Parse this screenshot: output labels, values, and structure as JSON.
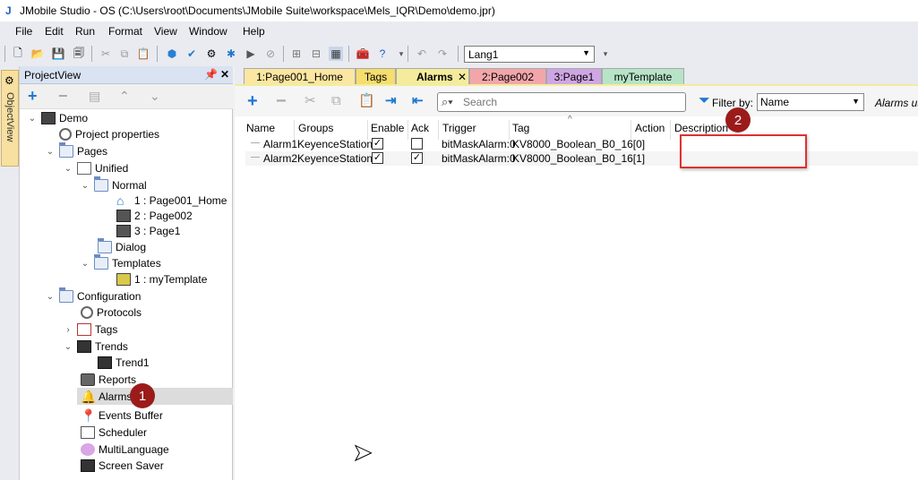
{
  "window": {
    "title": "JMobile Studio - OS (C:\\Users\\root\\Documents\\JMobile Suite\\workspace\\Mels_IQR\\Demo\\demo.jpr)",
    "logo": "J"
  },
  "menu": [
    "File",
    "Edit",
    "Run",
    "Format",
    "View",
    "Window",
    "Help"
  ],
  "toolbar": {
    "language": "Lang1"
  },
  "objectview": {
    "label": "ObjectView"
  },
  "projectview": {
    "title": "ProjectView",
    "tree": [
      {
        "label": "Demo",
        "icon": "monitor-icon",
        "expanded": true
      },
      {
        "label": "Project properties",
        "icon": "gear-icon"
      },
      {
        "label": "Pages",
        "icon": "folder-icon",
        "expanded": true
      },
      {
        "label": "Unified",
        "icon": "page-icon",
        "expanded": true
      },
      {
        "label": "Normal",
        "icon": "folder-icon",
        "expanded": true
      },
      {
        "label": "1 : Page001_Home",
        "icon": "home-icon"
      },
      {
        "label": "2 : Page002",
        "icon": "page-icon"
      },
      {
        "label": "3 : Page1",
        "icon": "page-icon"
      },
      {
        "label": "Dialog",
        "icon": "folder-icon"
      },
      {
        "label": "Templates",
        "icon": "folder-icon",
        "expanded": true
      },
      {
        "label": "1 : myTemplate",
        "icon": "template-icon"
      },
      {
        "label": "Configuration",
        "icon": "folder-icon",
        "expanded": true
      },
      {
        "label": "Protocols",
        "icon": "gear-icon"
      },
      {
        "label": "Tags",
        "icon": "tag-icon",
        "expanded": false
      },
      {
        "label": "Trends",
        "icon": "trend-icon",
        "expanded": true
      },
      {
        "label": "Trend1",
        "icon": "trend-icon"
      },
      {
        "label": "Reports",
        "icon": "printer-icon"
      },
      {
        "label": "Alarms",
        "icon": "bell-icon",
        "selected": true
      },
      {
        "label": "Events Buffer",
        "icon": "pin-icon"
      },
      {
        "label": "Scheduler",
        "icon": "calendar-icon"
      },
      {
        "label": "MultiLanguage",
        "icon": "bubble-icon"
      },
      {
        "label": "Screen Saver",
        "icon": "screen-icon"
      }
    ]
  },
  "badges": {
    "one": "1",
    "two": "2"
  },
  "tabs": [
    {
      "label": "1:Page001_Home",
      "color": "#fbe7a1"
    },
    {
      "label": "Tags",
      "color": "#f5dd6e"
    },
    {
      "label": "Alarms",
      "color": "#f4ec9c",
      "active": true
    },
    {
      "label": "2:Page002",
      "color": "#f3a6aa"
    },
    {
      "label": "3:Page1",
      "color": "#cfa6e4"
    },
    {
      "label": "myTemplate",
      "color": "#b7e4c7"
    }
  ],
  "alarms_editor": {
    "search_placeholder": "Search",
    "filter_label": "Filter by:",
    "filter_value": "Name",
    "note": "Alarms us",
    "columns": [
      "Name",
      "Groups",
      "Enable",
      "Ack",
      "Trigger",
      "Tag",
      "Action",
      "Description"
    ],
    "rows": [
      {
        "name": "Alarm1",
        "group": "KeyenceStation",
        "enable": true,
        "ack": false,
        "trigger": "bitMaskAlarm:0",
        "tag": "KV8000_Boolean_B0_16[0]",
        "action": "",
        "description": ""
      },
      {
        "name": "Alarm2",
        "group": "KeyenceStation",
        "enable": true,
        "ack": true,
        "trigger": "bitMaskAlarm:0",
        "tag": "KV8000_Boolean_B0_16[1]",
        "action": "",
        "description": ""
      }
    ]
  }
}
